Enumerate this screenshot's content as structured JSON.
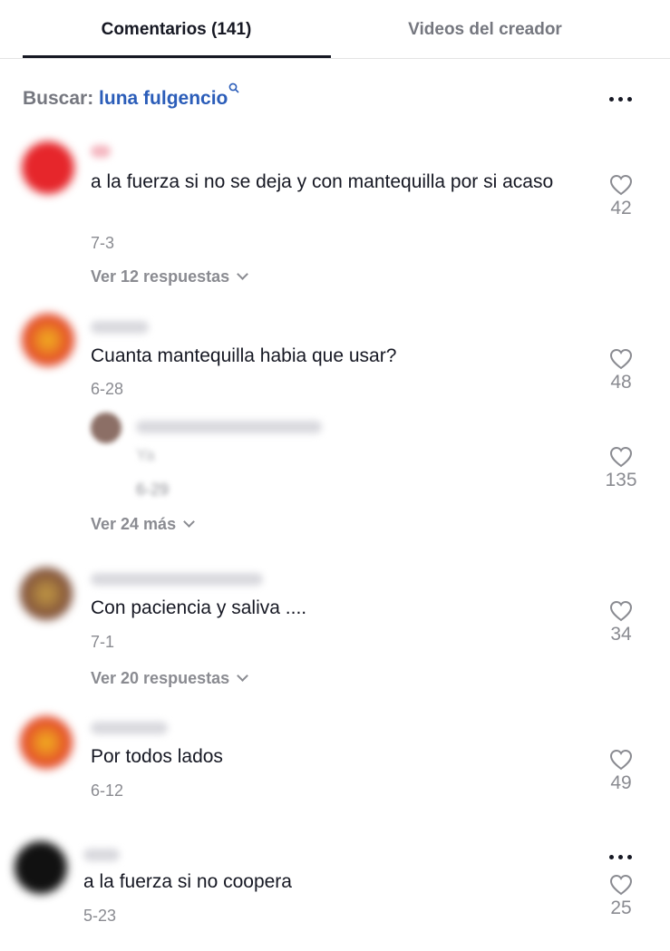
{
  "tabs": {
    "comments": "Comentarios (141)",
    "creator_videos": "Videos del creador"
  },
  "search": {
    "label": "Buscar:",
    "term": "luna fulgencio"
  },
  "comments": [
    {
      "text": "a la fuerza si no se deja y con mantequilla por si acaso",
      "date": "7-3",
      "likes": "42",
      "replies": "Ver 12 respuestas"
    },
    {
      "text": "Cuanta mantequilla habia que usar?",
      "date": "6-28",
      "likes": "48",
      "replies": "Ver 24 más",
      "reply": {
        "text": "Ya",
        "date": "6-29",
        "likes": "135"
      }
    },
    {
      "text": "Con paciencia y saliva ....",
      "date": "7-1",
      "likes": "34",
      "replies": "Ver 20 respuestas"
    },
    {
      "text": "Por todos lados",
      "date": "6-12",
      "likes": "49"
    },
    {
      "text": "a la fuerza si no coopera",
      "date": "5-23",
      "likes": "25"
    }
  ],
  "colors": {
    "accent_link": "#2b5db9",
    "muted": "#8a8b91",
    "primary_text": "#161823"
  }
}
